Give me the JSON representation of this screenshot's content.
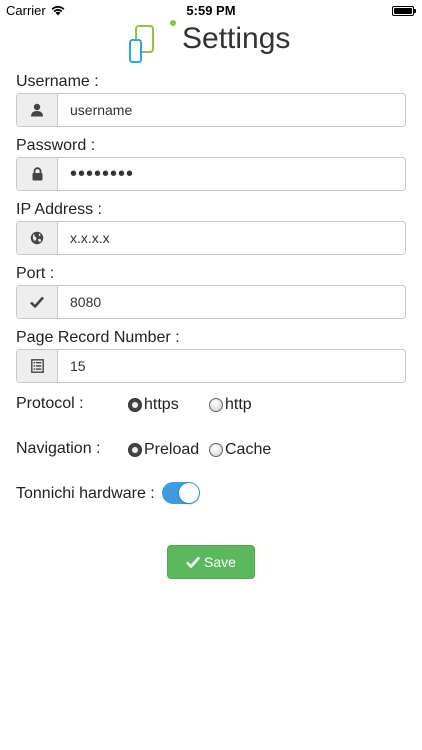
{
  "status_bar": {
    "carrier": "Carrier",
    "time": "5:59 PM",
    "icons": [
      "wifi-icon",
      "battery-icon"
    ]
  },
  "header": {
    "title": "Settings",
    "logo_colors": {
      "green": "#8cc63f",
      "blue": "#29a8e0"
    }
  },
  "form": {
    "username": {
      "label": "Username :",
      "value": "username",
      "icon": "user-icon"
    },
    "password": {
      "label": "Password :",
      "value": "••••••••",
      "icon": "lock-icon"
    },
    "ip_address": {
      "label": "IP Address :",
      "value": "x.x.x.x",
      "icon": "globe-icon"
    },
    "port": {
      "label": "Port :",
      "value": "8080",
      "icon": "check-icon"
    },
    "page_record_number": {
      "label": "Page Record Number :",
      "value": "15",
      "icon": "list-icon"
    },
    "protocol": {
      "label": "Protocol :",
      "options": [
        {
          "label": "https",
          "checked": true
        },
        {
          "label": "http",
          "checked": false
        }
      ]
    },
    "navigation": {
      "label": "Navigation :",
      "options": [
        {
          "label": "Preload",
          "checked": true
        },
        {
          "label": "Cache",
          "checked": false
        }
      ]
    },
    "tonnichi_hardware": {
      "label": "Tonnichi hardware :",
      "enabled": true
    }
  },
  "actions": {
    "save_label": "Save",
    "save_icon": "check-icon"
  },
  "colors": {
    "accent_green": "#5cb85c",
    "toggle_on": "#3d9be0",
    "addon_bg": "#eeeeee",
    "border": "#c8c8c8"
  }
}
